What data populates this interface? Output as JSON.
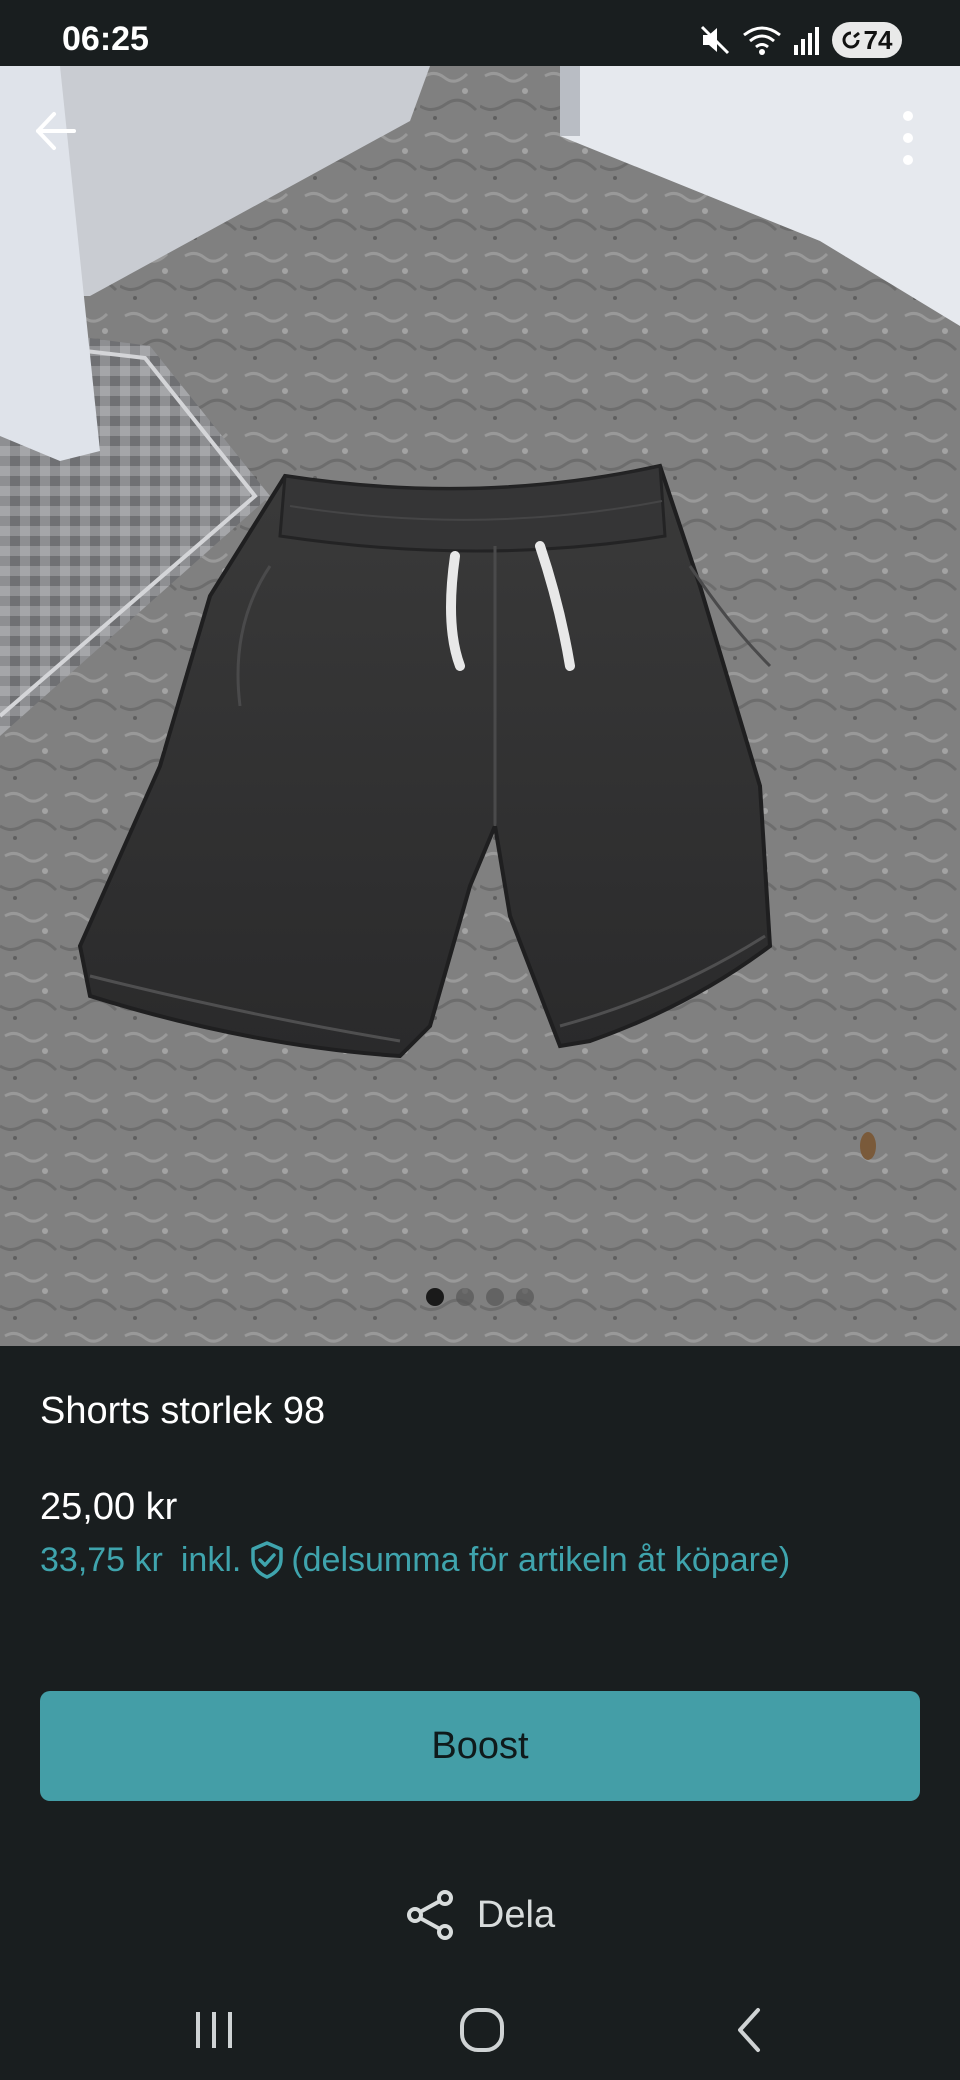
{
  "status_bar": {
    "time": "06:25",
    "battery": "74",
    "icons": [
      "mute-icon",
      "wifi-icon",
      "signal-icon",
      "battery-icon"
    ]
  },
  "photo": {
    "image_count": 4,
    "active_index": 0
  },
  "listing": {
    "title": "Shorts storlek 98",
    "price": "25,00 kr",
    "price_incl": "33,75 kr",
    "incl_label": "inkl.",
    "incl_note": "(delsumma för artikeln åt köpare)"
  },
  "actions": {
    "boost_label": "Boost",
    "share_label": "Dela"
  },
  "colors": {
    "accent": "#449ea7",
    "accent_text": "#3fa4ad",
    "background": "#191e1f"
  }
}
